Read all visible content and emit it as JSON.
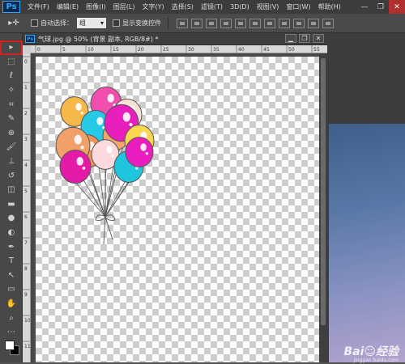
{
  "app": {
    "logo": "Ps"
  },
  "menubar": {
    "items": [
      "文件(F)",
      "编辑(E)",
      "图像(I)",
      "图层(L)",
      "文字(Y)",
      "选择(S)",
      "滤镜(T)",
      "3D(D)",
      "视图(V)",
      "窗口(W)",
      "帮助(H)"
    ],
    "window_controls": [
      "—",
      "❐",
      "✕"
    ]
  },
  "options": {
    "tool_glyph": "▸✛",
    "auto_select_label": "自动选择：",
    "auto_select_checked": false,
    "auto_select_value": "组",
    "show_transform_label": "显示变换控件",
    "show_transform_checked": false
  },
  "toolbar": {
    "tools": [
      {
        "name": "move-tool",
        "glyph": "▸",
        "selected": true
      },
      {
        "name": "marquee-tool",
        "glyph": "⬚"
      },
      {
        "name": "lasso-tool",
        "glyph": "ℓ"
      },
      {
        "name": "quick-select-tool",
        "glyph": "✧"
      },
      {
        "name": "crop-tool",
        "glyph": "⌗"
      },
      {
        "name": "eyedropper-tool",
        "glyph": "✎"
      },
      {
        "name": "healing-tool",
        "glyph": "⊕"
      },
      {
        "name": "brush-tool",
        "glyph": "🖌"
      },
      {
        "name": "stamp-tool",
        "glyph": "⊥"
      },
      {
        "name": "history-brush-tool",
        "glyph": "↺"
      },
      {
        "name": "eraser-tool",
        "glyph": "◫"
      },
      {
        "name": "gradient-tool",
        "glyph": "▬"
      },
      {
        "name": "blur-tool",
        "glyph": "●"
      },
      {
        "name": "dodge-tool",
        "glyph": "◐"
      },
      {
        "name": "pen-tool",
        "glyph": "✒"
      },
      {
        "name": "type-tool",
        "glyph": "T"
      },
      {
        "name": "path-select-tool",
        "glyph": "↖"
      },
      {
        "name": "shape-tool",
        "glyph": "▭"
      },
      {
        "name": "hand-tool",
        "glyph": "✋"
      },
      {
        "name": "zoom-tool",
        "glyph": "⌕"
      },
      {
        "name": "extra-tool",
        "glyph": "⋯"
      }
    ],
    "fg_color": "#ffffff",
    "bg_color": "#000000"
  },
  "document": {
    "icon": "Ps",
    "title": "气球.jpg @ 50% (背景 副本, RGB/8#) *",
    "controls": [
      "▁",
      "❐",
      "✕"
    ],
    "ruler_top": [
      "0",
      "5",
      "10",
      "15",
      "20",
      "25",
      "30",
      "35",
      "40",
      "45",
      "50",
      "55"
    ],
    "ruler_left": [
      "0",
      "1",
      "2",
      "3",
      "4",
      "5",
      "6",
      "7",
      "8",
      "9",
      "10",
      "11"
    ]
  },
  "balloons": [
    {
      "color": "#f7b84a"
    },
    {
      "color": "#f04fb0"
    },
    {
      "color": "#fbe0d6"
    },
    {
      "color": "#26c9e6"
    },
    {
      "color": "#f5a56b"
    },
    {
      "color": "#e81ebd"
    },
    {
      "color": "#fbd64f"
    },
    {
      "color": "#f28f5a"
    },
    {
      "color": "#fbd9dc"
    },
    {
      "color": "#f2a06a"
    },
    {
      "color": "#e41aa8"
    },
    {
      "color": "#1fc4dd"
    },
    {
      "color": "#ea1ec0"
    }
  ],
  "watermark": {
    "big": "Bai☺经验",
    "small": "jingyan.baidu.com"
  }
}
